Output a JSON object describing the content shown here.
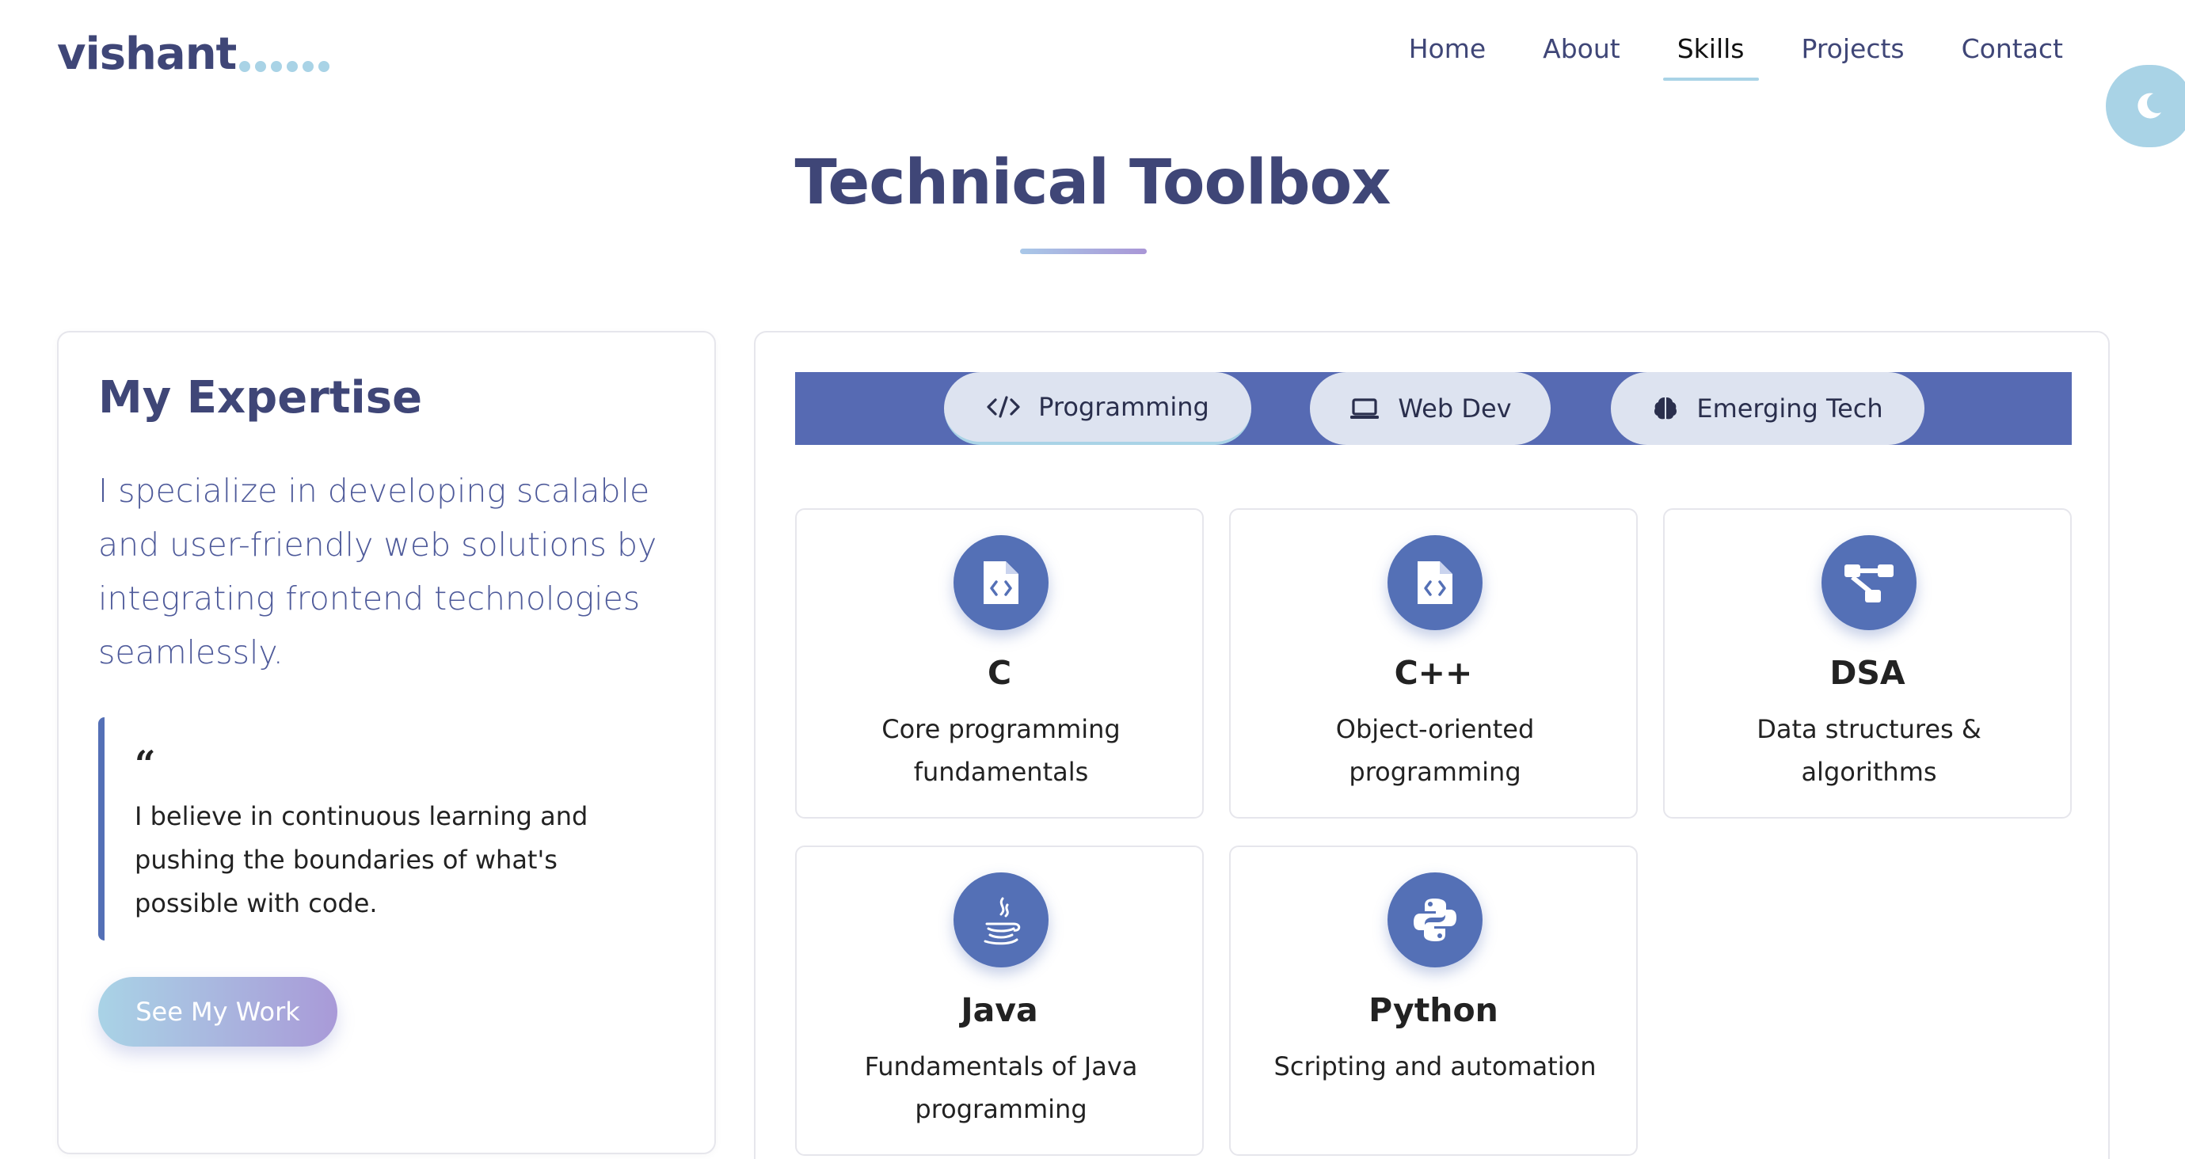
{
  "header": {
    "logo": "vishant",
    "nav": [
      {
        "label": "Home"
      },
      {
        "label": "About"
      },
      {
        "label": "Skills"
      },
      {
        "label": "Projects"
      },
      {
        "label": "Contact"
      }
    ],
    "active_nav": "Skills",
    "theme_icon": "moon-icon"
  },
  "page": {
    "title": "Technical Toolbox"
  },
  "expertise": {
    "title": "My Expertise",
    "description": "I specialize in developing scalable and user-friendly web solutions by integrating frontend technologies seamlessly.",
    "quote": "I believe in continuous learning and pushing the boundaries of what's possible with code.",
    "button_label": "See My Work"
  },
  "skills": {
    "tabs": [
      {
        "label": "Programming",
        "icon": "code-icon"
      },
      {
        "label": "Web Dev",
        "icon": "laptop-icon"
      },
      {
        "label": "Emerging Tech",
        "icon": "brain-icon"
      }
    ],
    "active_tab": "Programming",
    "cards": [
      {
        "name": "C",
        "description": "Core programming fundamentals",
        "icon": "code-file-icon"
      },
      {
        "name": "C++",
        "description": "Object-oriented programming",
        "icon": "code-file-icon"
      },
      {
        "name": "DSA",
        "description": "Data structures & algorithms",
        "icon": "sitemap-icon"
      },
      {
        "name": "Java",
        "description": "Fundamentals of Java programming",
        "icon": "java-icon"
      },
      {
        "name": "Python",
        "description": "Scripting and automation",
        "icon": "python-icon"
      }
    ]
  },
  "colors": {
    "primary": "#3f4677",
    "accent": "#5470b6",
    "light_accent": "#a9d3e6",
    "gradient_end": "#a99ad8"
  }
}
